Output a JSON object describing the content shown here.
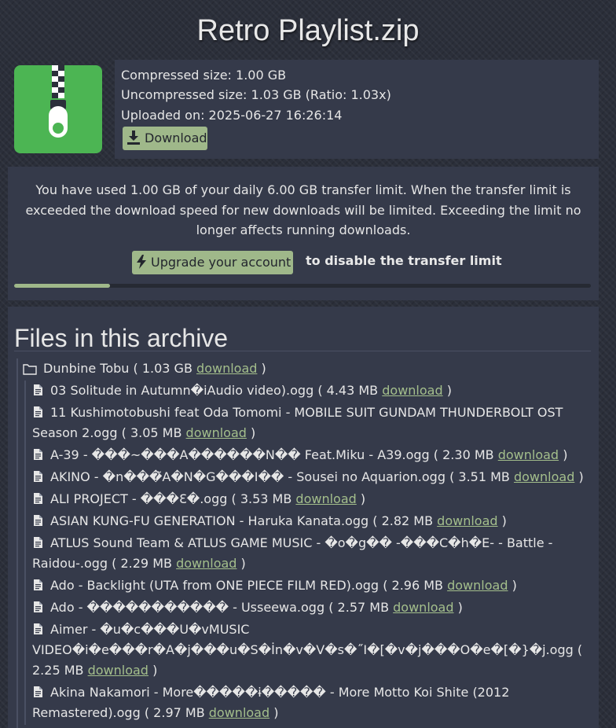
{
  "page": {
    "title": "Retro Playlist.zip"
  },
  "file_info": {
    "compressed": "Compressed size: 1.00 GB",
    "uncompressed": "Uncompressed size: 1.03 GB (Ratio: 1.03x)",
    "uploaded": "Uploaded on: 2025-06-27 16:26:14",
    "download_label": "Download",
    "icon": "zip-file-icon"
  },
  "transfer": {
    "notice": "You have used 1.00 GB of your daily 6.00 GB transfer limit. When the transfer limit is exceeded the download speed for new downloads will be limited. Exceeding the limit no longer affects running downloads.",
    "upgrade_label": "Upgrade your account",
    "after_upgrade": "to disable the transfer limit",
    "used_fraction": 0.1667
  },
  "archive": {
    "heading": "Files in this archive",
    "folder": {
      "name": "Dunbine Tobu",
      "size": "( 1.03 GB",
      "link": "download",
      "close": ")"
    },
    "files": [
      {
        "name": "03 Solitude in Autumn�iAudio video).ogg",
        "size": "( 4.43 MB",
        "link": "download",
        "close": ")"
      },
      {
        "name": "11 Kushimotobushi feat Oda Tomomi - MOBILE SUIT GUNDAM THUNDERBOLT OST Season 2.ogg",
        "size": "( 3.05 MB",
        "link": "download",
        "close": ")"
      },
      {
        "name": "A-39 - ���~���A������N�� Feat.Miku - A39.ogg",
        "size": "( 2.30 MB",
        "link": "download",
        "close": ")"
      },
      {
        "name": "AKINO - �n���̃A�N�G���I�� - Sousei no Aquarion.ogg",
        "size": "( 3.51 MB",
        "link": "download",
        "close": ")"
      },
      {
        "name": "ALI PROJECT - ���Ɛ�.ogg",
        "size": "( 3.53 MB",
        "link": "download",
        "close": ")"
      },
      {
        "name": "ASIAN KUNG-FU GENERATION - Haruka Kanata.ogg",
        "size": "( 2.82 MB",
        "link": "download",
        "close": ")"
      },
      {
        "name": "ATLUS Sound Team & ATLUS GAME MUSIC - �o�g�� -���C�h�E- - Battle - Raidou-.ogg",
        "size": "( 2.29 MB",
        "link": "download",
        "close": ")"
      },
      {
        "name": "Ado - Backlight (UTA from ONE PIECE FILM RED).ogg",
        "size": "( 2.96 MB",
        "link": "download",
        "close": ")"
      },
      {
        "name": "Ado - ����������� - Usseewa.ogg",
        "size": "( 2.57 MB",
        "link": "download",
        "close": ")"
      },
      {
        "name": "Aimer - �u�c���U�vMUSIC VIDEO�i�e���r�A�j���u�S�İn�v�V�s�˝I�[�v�j���O�e�[�}�j.ogg",
        "size": "( 2.25 MB",
        "link": "download",
        "close": ")"
      },
      {
        "name": "Akina Nakamori - More�����ɨ����� - More Motto Koi Shite (2012 Remastered).ogg",
        "size": "( 2.97 MB",
        "link": "download",
        "close": ")"
      }
    ]
  },
  "colors": {
    "accent": "#9fb88a",
    "link": "#a4bf8c",
    "panel": "#353a4a",
    "icon_green": "#4cb553"
  }
}
